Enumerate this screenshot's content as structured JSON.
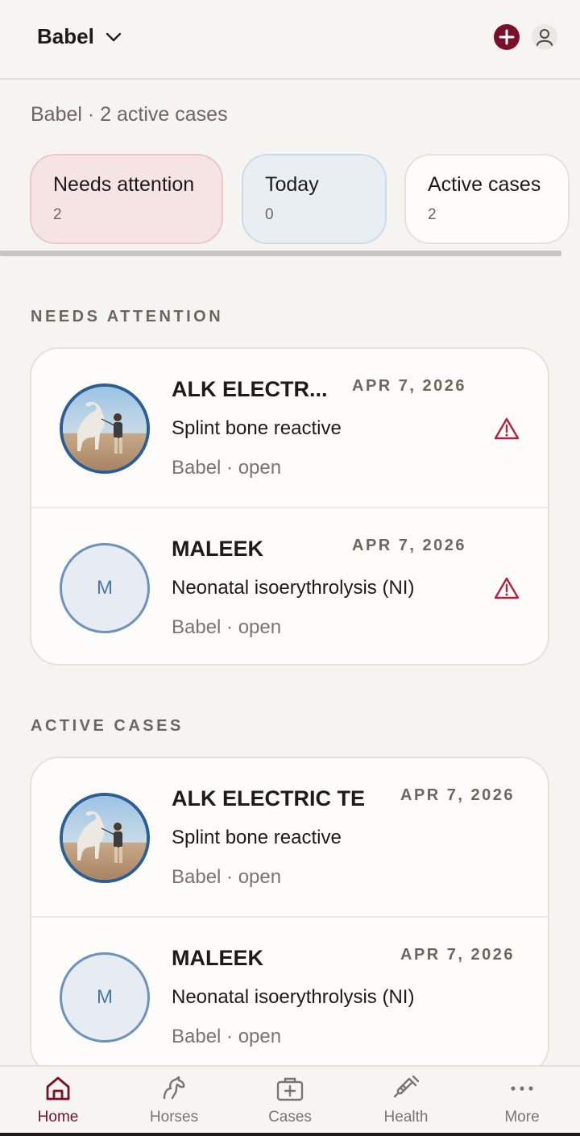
{
  "header": {
    "org_name": "Babel"
  },
  "subtitle": "Babel · 2 active cases",
  "stats": [
    {
      "label": "Needs attention",
      "count": "2"
    },
    {
      "label": "Today",
      "count": "0"
    },
    {
      "label": "Active cases",
      "count": "2"
    }
  ],
  "sections": {
    "needs_attention": {
      "title": "NEEDS ATTENTION",
      "cases": [
        {
          "horse": "ALK ELECTR...",
          "date": "APR 7, 2026",
          "title": "Splint bone reactive",
          "meta": "Babel · open",
          "avatar_initial": ""
        },
        {
          "horse": "MALEEK",
          "date": "APR 7, 2026",
          "title": "Neonatal isoerythrolysis (NI)",
          "meta": "Babel · open",
          "avatar_initial": "M"
        }
      ]
    },
    "active_cases": {
      "title": "ACTIVE CASES",
      "cases": [
        {
          "horse": "ALK ELECTRIC TE",
          "date": "APR 7, 2026",
          "title": "Splint bone reactive",
          "meta": "Babel · open",
          "avatar_initial": ""
        },
        {
          "horse": "MALEEK",
          "date": "APR 7, 2026",
          "title": "Neonatal isoerythrolysis (NI)",
          "meta": "Babel · open",
          "avatar_initial": "M"
        }
      ]
    }
  },
  "nav": [
    {
      "label": "Home",
      "icon": "home-icon",
      "active": true
    },
    {
      "label": "Horses",
      "icon": "horse-icon",
      "active": false
    },
    {
      "label": "Cases",
      "icon": "medical-kit-icon",
      "active": false
    },
    {
      "label": "Health",
      "icon": "syringe-icon",
      "active": false
    },
    {
      "label": "More",
      "icon": "more-dots-icon",
      "active": false
    }
  ],
  "colors": {
    "brand": "#7a0f2a",
    "alert": "#b3203a",
    "background": "#f6f4f1",
    "avatar_ring": "#2b5f93"
  }
}
